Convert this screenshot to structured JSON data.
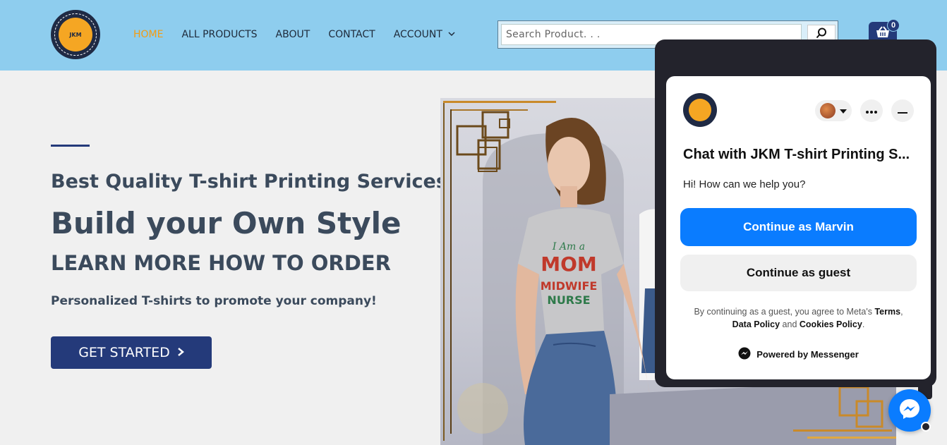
{
  "header": {
    "logo_alt": "T-SHIRT PRINTING SERVICES - BUILD YOUR OWN STYLE",
    "logo_center_text": "JKM",
    "nav": [
      {
        "label": "HOME",
        "active": true
      },
      {
        "label": "ALL PRODUCTS",
        "active": false
      },
      {
        "label": "ABOUT",
        "active": false
      },
      {
        "label": "CONTACT",
        "active": false
      },
      {
        "label": "ACCOUNT",
        "active": false,
        "has_dropdown": true
      }
    ],
    "search": {
      "placeholder": "Search Product. . ."
    },
    "cart": {
      "count": "0"
    }
  },
  "hero": {
    "subtitle": "Best Quality T-shirt Printing Services",
    "title": "Build your Own Style",
    "learn_more": "LEARN MORE HOW TO ORDER",
    "description": "Personalized T-shirts to promote your company!",
    "cta_label": "GET STARTED",
    "image_shirt_text": [
      "I Am a",
      "MOM",
      "MIDWIFE",
      "NURSE"
    ]
  },
  "chat": {
    "title": "Chat with JKM T-shirt Printing S...",
    "greeting": "Hi! How can we help you?",
    "primary_button": "Continue as Marvin",
    "secondary_button": "Continue as guest",
    "legal_prefix": "By continuing as a guest, you agree to Meta's",
    "legal_terms": "Terms",
    "legal_data_policy": "Data Policy",
    "legal_and": "and",
    "legal_cookies": "Cookies Policy",
    "powered_by": "Powered by Messenger"
  },
  "colors": {
    "header_bg": "#8ecdee",
    "brand_navy": "#243a7a",
    "nav_active": "#f39c12",
    "messenger_blue": "#0a7cff"
  },
  "icons": {
    "search": "magnifier-icon",
    "cart": "shopping-basket-icon",
    "messenger": "messenger-icon"
  }
}
